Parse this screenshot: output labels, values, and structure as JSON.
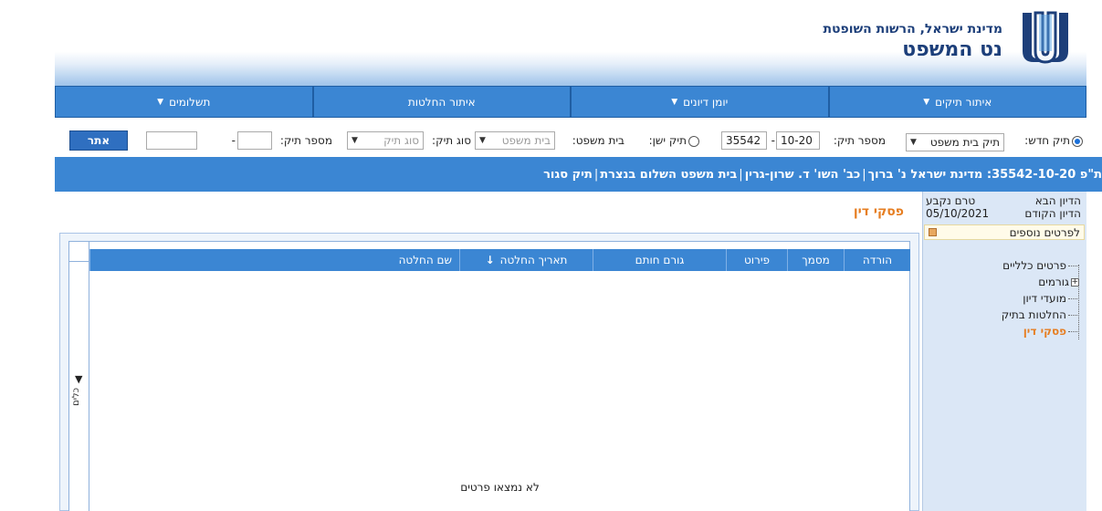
{
  "brand": {
    "line1": "מדינת ישראל, הרשות השופטת",
    "line2": "נט המשפט"
  },
  "nav": [
    {
      "label": "איתור תיקים",
      "has_dropdown": true
    },
    {
      "label": "יומן דיונים",
      "has_dropdown": true
    },
    {
      "label": "איתור החלטות",
      "has_dropdown": false
    },
    {
      "label": "תשלומים",
      "has_dropdown": true
    }
  ],
  "search": {
    "new_case_label": "תיק חדש:",
    "court_case_type": "תיק בית משפט",
    "case_number_label": "מספר תיק:",
    "case_num_part1": "35542",
    "case_num_part2": "10-20",
    "dash": "-",
    "old_case_label": "תיק ישן:",
    "court_label": "בית משפט:",
    "court_value": "בית משפט",
    "case_type_label": "סוג תיק:",
    "case_type_value": "סוג תיק",
    "old_case_number_label": "מספר תיק:",
    "old_num_part1": "",
    "old_num_part2": "",
    "search_button": "אתר"
  },
  "case": {
    "title": "ת\"פ 35542-10-20: מדינת ישראל נ' ברוך",
    "judge": "כב' השו' ד. שרון-גרין",
    "court": "בית משפט השלום בנצרת",
    "status": "תיק סגור",
    "separator": "|"
  },
  "sidebar": {
    "next_hearing_label": "הדיון הבא",
    "next_hearing_value": "טרם נקבע",
    "prev_hearing_label": "הדיון הקודם",
    "prev_hearing_value": "05/10/2021",
    "more_details": "לפרטים נוספים",
    "tree": [
      {
        "label": "פרטים כלליים",
        "expandable": false,
        "active": false
      },
      {
        "label": "גורמים",
        "expandable": true,
        "active": false
      },
      {
        "label": "מועדי דיון",
        "expandable": false,
        "active": false
      },
      {
        "label": "החלטות בתיק",
        "expandable": false,
        "active": false
      },
      {
        "label": "פסקי דין",
        "expandable": false,
        "active": true
      }
    ]
  },
  "main": {
    "page_title": "פסקי דין",
    "filter_tool_label": "כלים",
    "columns": [
      {
        "label": "שם החלטה"
      },
      {
        "label": "תאריך החלטה",
        "sorted": true
      },
      {
        "label": "גורם חותם"
      },
      {
        "label": "פירוט"
      },
      {
        "label": "מסמך"
      },
      {
        "label": "הורדה"
      }
    ],
    "empty_message": "לא נמצאו פרטים"
  },
  "colors": {
    "primary_blue": "#3b86d3",
    "accent_orange": "#e67e22",
    "brand_navy": "#1d3f7a"
  }
}
